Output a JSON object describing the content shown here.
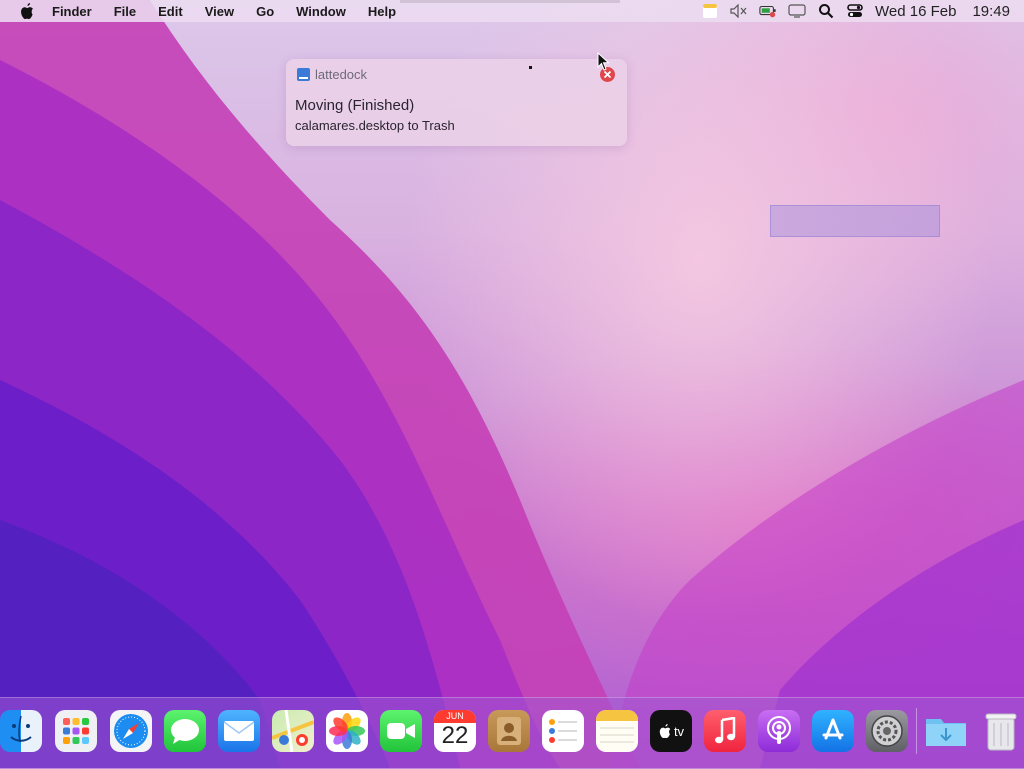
{
  "menubar": {
    "app_name": "Finder",
    "items": [
      "File",
      "Edit",
      "View",
      "Go",
      "Window",
      "Help"
    ],
    "clock_date": "Wed 16 Feb",
    "clock_time": "19:49",
    "status_icons": [
      "notes-icon",
      "speaker-muted-icon",
      "battery-icon",
      "display-icon",
      "search-icon",
      "control-center-icon"
    ]
  },
  "notification": {
    "app_name": "lattedock",
    "title": "Moving (Finished)",
    "body": "calamares.desktop to Trash",
    "close_icon": "close-icon"
  },
  "dock": {
    "apps": [
      {
        "name": "finder-icon"
      },
      {
        "name": "launchpad-icon"
      },
      {
        "name": "safari-icon"
      },
      {
        "name": "messages-icon"
      },
      {
        "name": "mail-icon"
      },
      {
        "name": "maps-icon"
      },
      {
        "name": "photos-icon"
      },
      {
        "name": "facetime-icon"
      },
      {
        "name": "calendar-icon",
        "month": "JUN",
        "day": "22"
      },
      {
        "name": "contacts-icon"
      },
      {
        "name": "reminders-icon"
      },
      {
        "name": "notes-icon"
      },
      {
        "name": "apple-tv-icon",
        "label": "tv"
      },
      {
        "name": "music-icon"
      },
      {
        "name": "podcasts-icon"
      },
      {
        "name": "app-store-icon"
      },
      {
        "name": "system-preferences-icon"
      },
      {
        "name": "downloads-folder-icon"
      },
      {
        "name": "trash-icon"
      }
    ]
  },
  "colors": {
    "accent_blue": "#3b7bd8",
    "close_red": "#e0474c",
    "calendar_red": "#ff3b30"
  }
}
